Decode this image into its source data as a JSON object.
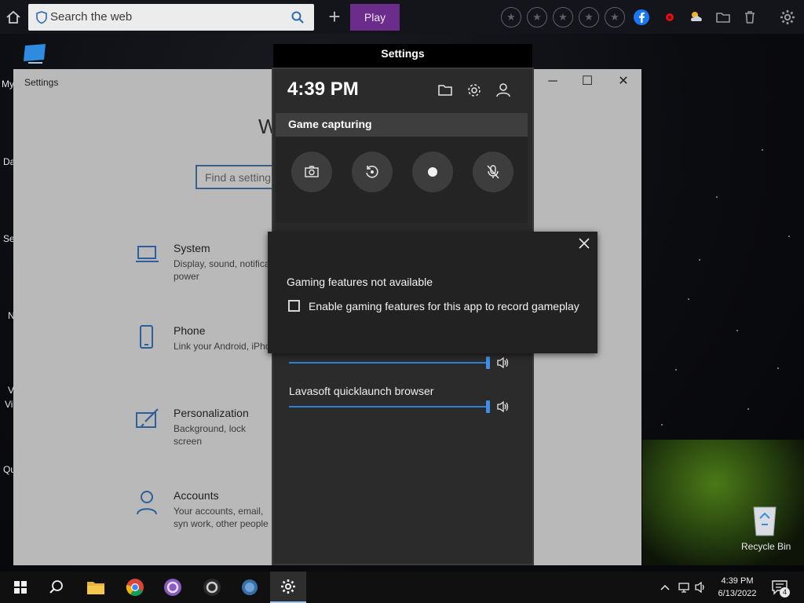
{
  "browser_bar": {
    "search_placeholder": "Search the web",
    "play_label": "Play"
  },
  "desktop": {
    "labels": [
      "My",
      "Da",
      "Se",
      "N",
      "V",
      "Vi",
      "Qu"
    ],
    "recycle_bin_label": "Recycle Bin"
  },
  "settings_window": {
    "title": "Settings",
    "welcome": "W",
    "find_placeholder": "Find a setting",
    "categories": [
      {
        "title": "System",
        "desc": "Display, sound, notifica power",
        "icon": "laptop-icon"
      },
      {
        "title": "Phone",
        "desc": "Link your Android, iPho",
        "icon": "phone-icon"
      },
      {
        "title": "Personalization",
        "desc": "Background, lock screen",
        "icon": "paintbrush-icon"
      },
      {
        "title": "Accounts",
        "desc": "Your accounts, email, syn work, other people",
        "icon": "person-icon"
      }
    ]
  },
  "game_bar": {
    "header_title": "Settings",
    "time": "4:39 PM",
    "capture_title": "Game capturing",
    "capture_buttons": [
      "screenshot",
      "record-last-30s",
      "start-recording",
      "mic-toggle"
    ],
    "audio_apps": [
      {
        "name": "",
        "volume": 1.0
      },
      {
        "name": "Lavasoft quicklaunch browser",
        "volume": 1.0
      }
    ]
  },
  "dialog": {
    "message": "Gaming features not available",
    "checkbox_label": "Enable gaming features for this app to record gameplay",
    "checked": false
  },
  "taskbar": {
    "time": "4:39 PM",
    "date": "6/13/2022",
    "notification_count": "4",
    "accent": "#a0c4ec"
  },
  "colors": {
    "play_button": "#6b2c8c",
    "slider": "#2f7ed8",
    "icon_blue": "#2d6ab0"
  }
}
